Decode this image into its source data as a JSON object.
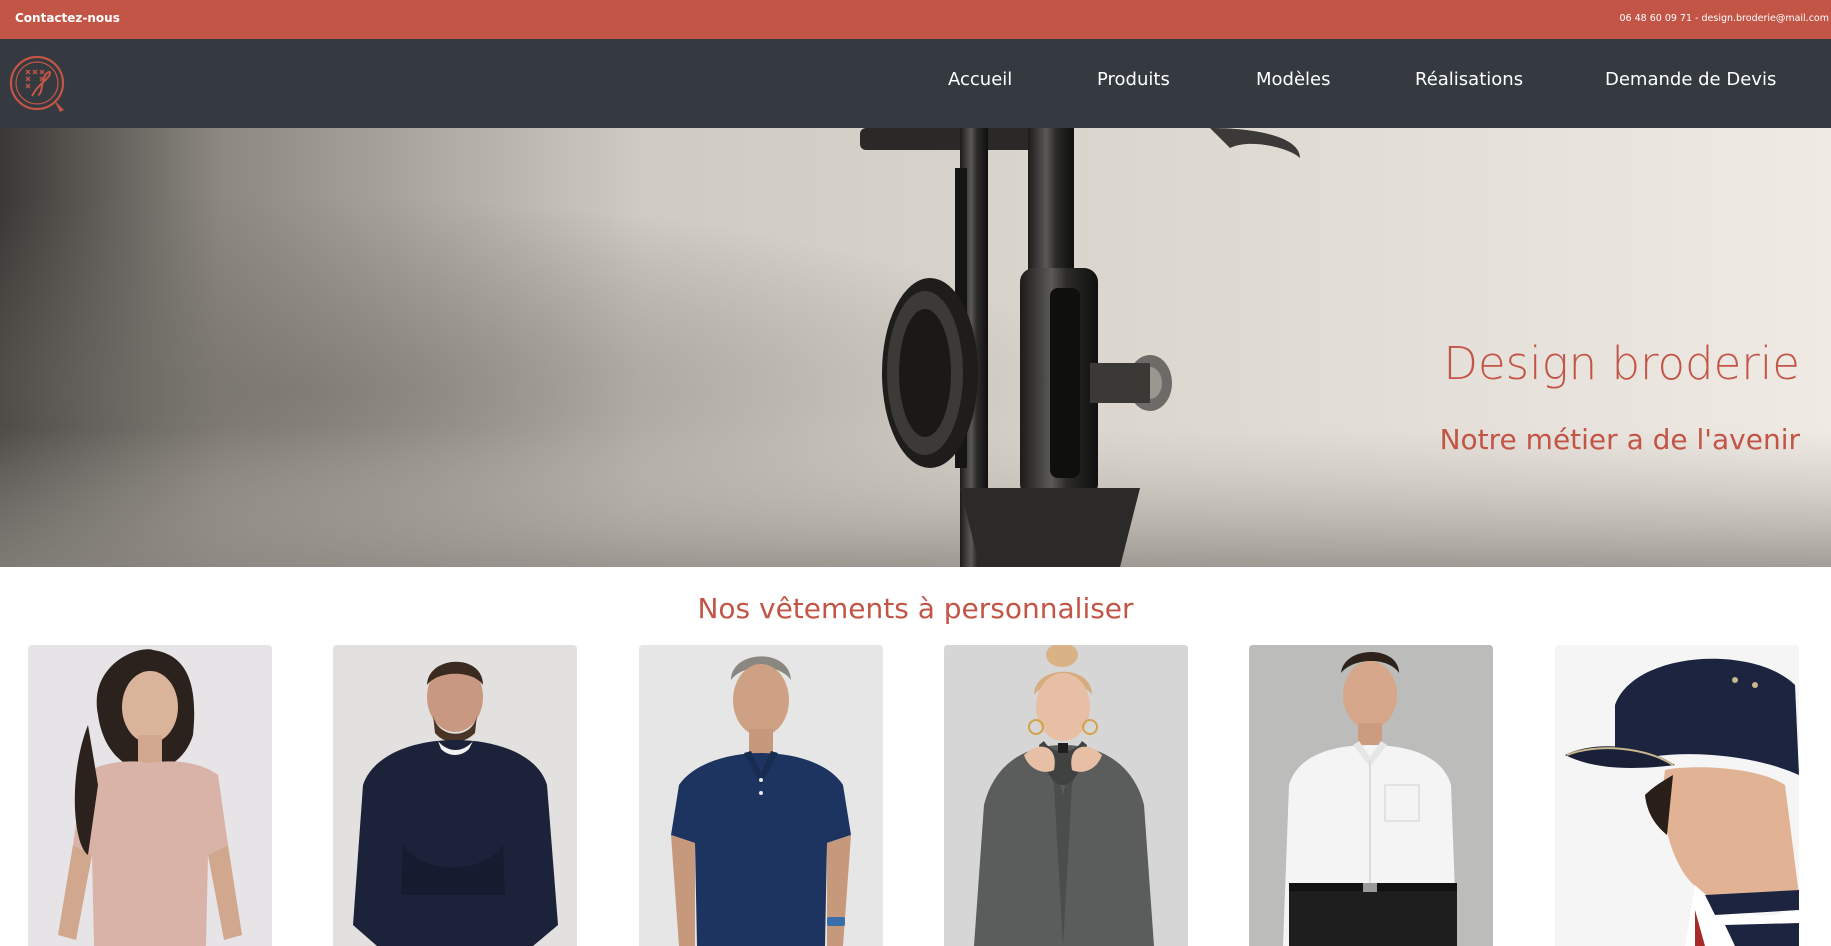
{
  "topbar": {
    "contact_label": "Contactez-nous",
    "info_text": "06 48 60 09 71 - design.broderie@mail.com"
  },
  "nav": {
    "items": [
      {
        "label": "Accueil"
      },
      {
        "label": "Produits"
      },
      {
        "label": "Modèles"
      },
      {
        "label": "Réalisations"
      },
      {
        "label": "Demande de Devis"
      }
    ]
  },
  "hero": {
    "title": "Design broderie",
    "subtitle": "Notre métier a de l'avenir"
  },
  "products_section": {
    "title": "Nos vêtements à personnaliser",
    "items": [
      {
        "image": "woman-pink-tshirt"
      },
      {
        "image": "man-navy-sweatshirt"
      },
      {
        "image": "man-navy-polo"
      },
      {
        "image": "woman-grey-fleece"
      },
      {
        "image": "man-white-shirt"
      },
      {
        "image": "navy-cap"
      }
    ]
  },
  "colors": {
    "accent": "#c35547",
    "nav_background": "#343a40",
    "topbar_background": "#c35547"
  }
}
